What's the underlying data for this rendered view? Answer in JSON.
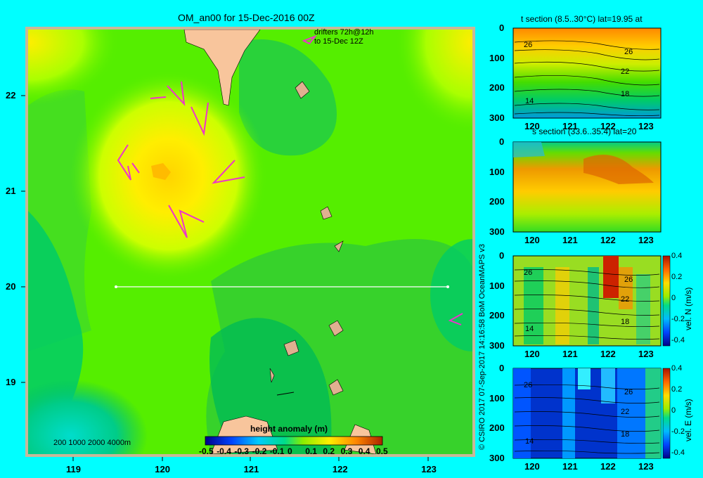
{
  "main": {
    "title": "OM_an00 for 15-Dec-2016 00Z",
    "drifters_line1": "drifters 72h@12h",
    "drifters_line2": "to 15-Dec 12Z",
    "bathymetry_label": "200  1000  2000  4000m",
    "colorbar_title": "height anomaly (m)",
    "colorbar_ticks": [
      "-0.5",
      "-0.4",
      "-0.3",
      "-0.2",
      "-0.1",
      "0",
      "0.1",
      "0.2",
      "0.3",
      "0.4",
      "0.5"
    ],
    "lon_ticks": [
      "119",
      "120",
      "121",
      "122",
      "123"
    ],
    "lat_ticks": [
      "22",
      "21",
      "20",
      "19"
    ]
  },
  "credit": "© CSIRO 2017   07-Sep-2017 14:16:58 BoM OceanMAPS v3",
  "panels": [
    {
      "title": "t section (8.5..30°C) lat=19.95 at",
      "contours": [
        "26",
        "26",
        "22",
        "18",
        "14"
      ]
    },
    {
      "title": "s section (33.6..35.4) lat=20",
      "contours": []
    },
    {
      "title": "",
      "cbar_label": "vel. N (m/s)",
      "contours": [
        "26",
        "26",
        "22",
        "18",
        "14"
      ]
    },
    {
      "title": "",
      "cbar_label": "vel. E (m/s)",
      "contours": [
        "26",
        "26",
        "22",
        "18",
        "14"
      ]
    }
  ],
  "panel_xticks": [
    "120",
    "121",
    "122",
    "123"
  ],
  "panel_yticks": [
    "0",
    "100",
    "200",
    "300"
  ],
  "vel_ticks": [
    "0.4",
    "0.2",
    "0",
    "-0.2",
    "-0.4"
  ],
  "chart_data": {
    "type": "heatmap",
    "title": "OM_an00 for 15-Dec-2016 00Z",
    "xlim": [
      118.5,
      123.5
    ],
    "ylim": [
      18.2,
      22.7
    ],
    "colorbar": {
      "label": "height anomaly (m)",
      "range": [
        -0.5,
        0.5
      ]
    },
    "section_line": {
      "lat": 20,
      "lon": [
        119.5,
        123.2
      ]
    },
    "field_peaks": [
      {
        "lon": 120.0,
        "lat": 21.2,
        "value": 0.18
      },
      {
        "lon": 118.5,
        "lat": 22.5,
        "value": 0.14
      },
      {
        "lon": 123.5,
        "lat": 22.5,
        "value": 0.13
      },
      {
        "lon": 120.5,
        "lat": 18.8,
        "value": -0.08
      }
    ],
    "sections": [
      {
        "name": "t section",
        "var_range": [
          8.5,
          30
        ],
        "xlim": [
          119.5,
          123.2
        ],
        "ylim": [
          300,
          0
        ],
        "contour_levels": [
          14,
          18,
          22,
          26
        ]
      },
      {
        "name": "s section",
        "var_range": [
          33.6,
          35.4
        ],
        "xlim": [
          119.5,
          123.2
        ],
        "ylim": [
          300,
          0
        ]
      },
      {
        "name": "vel. N (m/s)",
        "var_range": [
          -0.4,
          0.4
        ],
        "xlim": [
          119.5,
          123.2
        ],
        "ylim": [
          300,
          0
        ]
      },
      {
        "name": "vel. E (m/s)",
        "var_range": [
          -0.4,
          0.4
        ],
        "xlim": [
          119.5,
          123.2
        ],
        "ylim": [
          300,
          0
        ]
      }
    ]
  }
}
